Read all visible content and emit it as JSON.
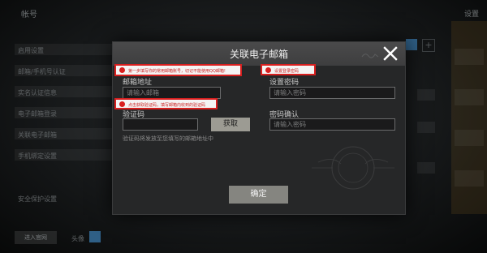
{
  "background": {
    "title": "帐号",
    "right_tab": "设置",
    "rows": [
      "启用设置",
      "邮箱/手机号认证",
      "实名认证信息",
      "电子邮箱登录",
      "关联电子邮箱",
      "手机绑定设置"
    ],
    "footer_row": "安全保护设置",
    "bottom_button": "进入官网",
    "bottom_label": "头像"
  },
  "dialog": {
    "title": "关联电子邮箱",
    "email_label": "邮箱地址",
    "email_placeholder": "请输入邮箱",
    "code_label": "验证码",
    "code_placeholder": "",
    "get_code_button": "获取",
    "hint": "验证码将发放至您填写的邮箱地址中",
    "password_label": "设置密码",
    "password_placeholder": "请输入密码",
    "confirm_label": "密码确认",
    "confirm_placeholder": "请输入密码",
    "confirm_button": "确定"
  },
  "annotations": [
    {
      "text": "第一步填写你的常用邮箱账号，切记不能使用QQ邮箱!"
    },
    {
      "text": "点击获取验证码，填写邮箱内收到的验证码"
    },
    {
      "text": "设置登录密码"
    }
  ],
  "colors": {
    "annotation_red": "#d81f1f",
    "header_bg": "#444445",
    "dialog_bg": "#262728"
  },
  "icons": {
    "close": "close-icon"
  }
}
